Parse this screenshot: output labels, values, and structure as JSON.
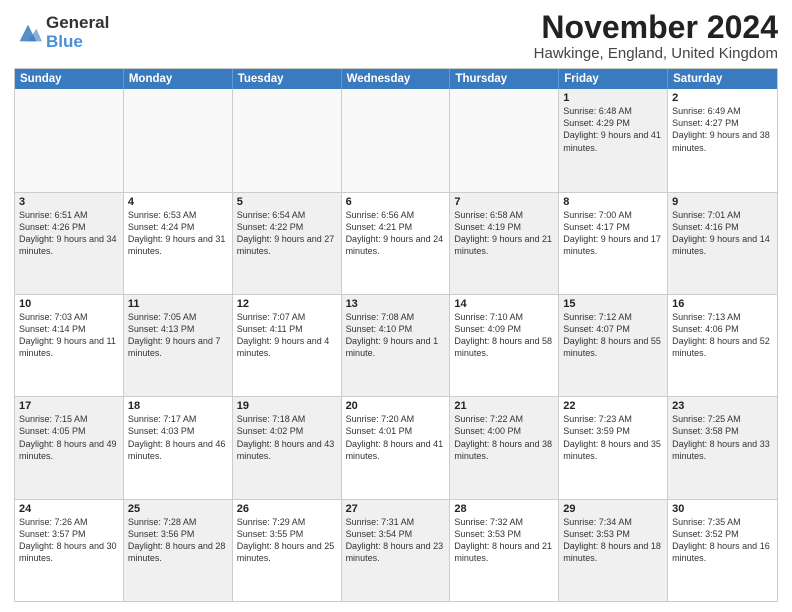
{
  "logo": {
    "general": "General",
    "blue": "Blue"
  },
  "title": {
    "month": "November 2024",
    "location": "Hawkinge, England, United Kingdom"
  },
  "header_days": [
    "Sunday",
    "Monday",
    "Tuesday",
    "Wednesday",
    "Thursday",
    "Friday",
    "Saturday"
  ],
  "weeks": [
    [
      {
        "day": "",
        "text": "",
        "empty": true
      },
      {
        "day": "",
        "text": "",
        "empty": true
      },
      {
        "day": "",
        "text": "",
        "empty": true
      },
      {
        "day": "",
        "text": "",
        "empty": true
      },
      {
        "day": "",
        "text": "",
        "empty": true
      },
      {
        "day": "1",
        "text": "Sunrise: 6:48 AM\nSunset: 4:29 PM\nDaylight: 9 hours and 41 minutes.",
        "shaded": true
      },
      {
        "day": "2",
        "text": "Sunrise: 6:49 AM\nSunset: 4:27 PM\nDaylight: 9 hours and 38 minutes.",
        "shaded": false
      }
    ],
    [
      {
        "day": "3",
        "text": "Sunrise: 6:51 AM\nSunset: 4:26 PM\nDaylight: 9 hours and 34 minutes.",
        "shaded": true
      },
      {
        "day": "4",
        "text": "Sunrise: 6:53 AM\nSunset: 4:24 PM\nDaylight: 9 hours and 31 minutes.",
        "shaded": false
      },
      {
        "day": "5",
        "text": "Sunrise: 6:54 AM\nSunset: 4:22 PM\nDaylight: 9 hours and 27 minutes.",
        "shaded": true
      },
      {
        "day": "6",
        "text": "Sunrise: 6:56 AM\nSunset: 4:21 PM\nDaylight: 9 hours and 24 minutes.",
        "shaded": false
      },
      {
        "day": "7",
        "text": "Sunrise: 6:58 AM\nSunset: 4:19 PM\nDaylight: 9 hours and 21 minutes.",
        "shaded": true
      },
      {
        "day": "8",
        "text": "Sunrise: 7:00 AM\nSunset: 4:17 PM\nDaylight: 9 hours and 17 minutes.",
        "shaded": false
      },
      {
        "day": "9",
        "text": "Sunrise: 7:01 AM\nSunset: 4:16 PM\nDaylight: 9 hours and 14 minutes.",
        "shaded": true
      }
    ],
    [
      {
        "day": "10",
        "text": "Sunrise: 7:03 AM\nSunset: 4:14 PM\nDaylight: 9 hours and 11 minutes.",
        "shaded": false
      },
      {
        "day": "11",
        "text": "Sunrise: 7:05 AM\nSunset: 4:13 PM\nDaylight: 9 hours and 7 minutes.",
        "shaded": true
      },
      {
        "day": "12",
        "text": "Sunrise: 7:07 AM\nSunset: 4:11 PM\nDaylight: 9 hours and 4 minutes.",
        "shaded": false
      },
      {
        "day": "13",
        "text": "Sunrise: 7:08 AM\nSunset: 4:10 PM\nDaylight: 9 hours and 1 minute.",
        "shaded": true
      },
      {
        "day": "14",
        "text": "Sunrise: 7:10 AM\nSunset: 4:09 PM\nDaylight: 8 hours and 58 minutes.",
        "shaded": false
      },
      {
        "day": "15",
        "text": "Sunrise: 7:12 AM\nSunset: 4:07 PM\nDaylight: 8 hours and 55 minutes.",
        "shaded": true
      },
      {
        "day": "16",
        "text": "Sunrise: 7:13 AM\nSunset: 4:06 PM\nDaylight: 8 hours and 52 minutes.",
        "shaded": false
      }
    ],
    [
      {
        "day": "17",
        "text": "Sunrise: 7:15 AM\nSunset: 4:05 PM\nDaylight: 8 hours and 49 minutes.",
        "shaded": true
      },
      {
        "day": "18",
        "text": "Sunrise: 7:17 AM\nSunset: 4:03 PM\nDaylight: 8 hours and 46 minutes.",
        "shaded": false
      },
      {
        "day": "19",
        "text": "Sunrise: 7:18 AM\nSunset: 4:02 PM\nDaylight: 8 hours and 43 minutes.",
        "shaded": true
      },
      {
        "day": "20",
        "text": "Sunrise: 7:20 AM\nSunset: 4:01 PM\nDaylight: 8 hours and 41 minutes.",
        "shaded": false
      },
      {
        "day": "21",
        "text": "Sunrise: 7:22 AM\nSunset: 4:00 PM\nDaylight: 8 hours and 38 minutes.",
        "shaded": true
      },
      {
        "day": "22",
        "text": "Sunrise: 7:23 AM\nSunset: 3:59 PM\nDaylight: 8 hours and 35 minutes.",
        "shaded": false
      },
      {
        "day": "23",
        "text": "Sunrise: 7:25 AM\nSunset: 3:58 PM\nDaylight: 8 hours and 33 minutes.",
        "shaded": true
      }
    ],
    [
      {
        "day": "24",
        "text": "Sunrise: 7:26 AM\nSunset: 3:57 PM\nDaylight: 8 hours and 30 minutes.",
        "shaded": false
      },
      {
        "day": "25",
        "text": "Sunrise: 7:28 AM\nSunset: 3:56 PM\nDaylight: 8 hours and 28 minutes.",
        "shaded": true
      },
      {
        "day": "26",
        "text": "Sunrise: 7:29 AM\nSunset: 3:55 PM\nDaylight: 8 hours and 25 minutes.",
        "shaded": false
      },
      {
        "day": "27",
        "text": "Sunrise: 7:31 AM\nSunset: 3:54 PM\nDaylight: 8 hours and 23 minutes.",
        "shaded": true
      },
      {
        "day": "28",
        "text": "Sunrise: 7:32 AM\nSunset: 3:53 PM\nDaylight: 8 hours and 21 minutes.",
        "shaded": false
      },
      {
        "day": "29",
        "text": "Sunrise: 7:34 AM\nSunset: 3:53 PM\nDaylight: 8 hours and 18 minutes.",
        "shaded": true
      },
      {
        "day": "30",
        "text": "Sunrise: 7:35 AM\nSunset: 3:52 PM\nDaylight: 8 hours and 16 minutes.",
        "shaded": false
      }
    ]
  ]
}
